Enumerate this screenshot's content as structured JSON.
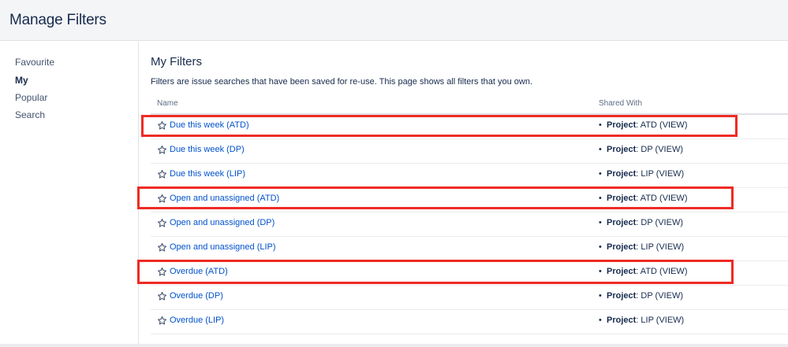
{
  "header": {
    "title": "Manage Filters"
  },
  "sidebar": {
    "items": [
      {
        "label": "Favourite",
        "active": false
      },
      {
        "label": "My",
        "active": true
      },
      {
        "label": "Popular",
        "active": false
      },
      {
        "label": "Search",
        "active": false
      }
    ]
  },
  "main": {
    "title": "My Filters",
    "description": "Filters are issue searches that have been saved for re-use. This page shows all filters that you own.",
    "columns": {
      "name": "Name",
      "shared_with": "Shared With"
    },
    "rows": [
      {
        "name": "Due this week (ATD)",
        "bullet": "•",
        "share_key": "Project",
        "share_value": ": ATD (VIEW)",
        "highlighted": true
      },
      {
        "name": "Due this week (DP)",
        "bullet": "•",
        "share_key": "Project",
        "share_value": ": DP (VIEW)",
        "highlighted": false
      },
      {
        "name": "Due this week (LIP)",
        "bullet": "•",
        "share_key": "Project",
        "share_value": ": LIP (VIEW)",
        "highlighted": false
      },
      {
        "name": "Open and unassigned (ATD)",
        "bullet": "•",
        "share_key": "Project",
        "share_value": ": ATD (VIEW)",
        "highlighted": true
      },
      {
        "name": "Open and unassigned (DP)",
        "bullet": "•",
        "share_key": "Project",
        "share_value": ": DP (VIEW)",
        "highlighted": false
      },
      {
        "name": "Open and unassigned (LIP)",
        "bullet": "•",
        "share_key": "Project",
        "share_value": ": LIP (VIEW)",
        "highlighted": false
      },
      {
        "name": "Overdue (ATD)",
        "bullet": "•",
        "share_key": "Project",
        "share_value": ": ATD (VIEW)",
        "highlighted": true
      },
      {
        "name": "Overdue (DP)",
        "bullet": "•",
        "share_key": "Project",
        "share_value": ": DP (VIEW)",
        "highlighted": false
      },
      {
        "name": "Overdue (LIP)",
        "bullet": "•",
        "share_key": "Project",
        "share_value": ": LIP (VIEW)",
        "highlighted": false
      }
    ]
  },
  "icons": {
    "favourite": "star-outline-icon"
  },
  "colors": {
    "link": "#0052cc",
    "highlight": "#ee2b24",
    "header_bg": "#f4f5f7"
  }
}
